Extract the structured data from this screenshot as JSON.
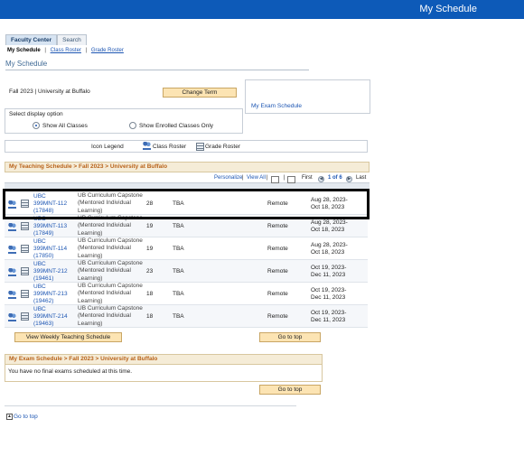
{
  "header": {
    "title": "My Schedule"
  },
  "tabs": [
    {
      "label": "Faculty Center",
      "active": true
    },
    {
      "label": "Search",
      "active": false
    }
  ],
  "subnav": {
    "current": "My Schedule",
    "links": [
      "Class Roster",
      "Grade Roster"
    ]
  },
  "page_title": "My Schedule",
  "term": {
    "label": "Fall 2023 | University at Buffalo",
    "change_button": "Change Term"
  },
  "exam_link": "My Exam Schedule",
  "display_option": {
    "label": "Select display option",
    "options": [
      {
        "label": "Show All Classes",
        "selected": true
      },
      {
        "label": "Show Enrolled Classes Only",
        "selected": false
      }
    ]
  },
  "legend": {
    "title": "Icon Legend",
    "class_roster": "Class Roster",
    "grade_roster": "Grade Roster"
  },
  "teaching": {
    "heading": "My Teaching Schedule > Fall 2023 > University at Buffalo",
    "nav": {
      "personalize": "Personalize",
      "view_all": "View All",
      "first": "First",
      "range": "1 of 6",
      "last": "Last"
    },
    "rows": [
      {
        "class_lines": [
          "UBC",
          "399MNT-112",
          "(17848)"
        ],
        "desc_lines": [
          "UB Curriculum Capstone",
          "(Mentored Individual",
          "Learning)"
        ],
        "enrolled": "28",
        "days_times": "TBA",
        "room": "Remote",
        "dates_lines": [
          "Aug 28, 2023-",
          "Oct 18, 2023"
        ]
      },
      {
        "class_lines": [
          "UBC",
          "399MNT-113",
          "(17849)"
        ],
        "desc_lines": [
          "UB Curriculum Capstone",
          "(Mentored Individual",
          "Learning)"
        ],
        "enrolled": "19",
        "days_times": "TBA",
        "room": "Remote",
        "dates_lines": [
          "Aug 28, 2023-",
          "Oct 18, 2023"
        ]
      },
      {
        "class_lines": [
          "UBC",
          "399MNT-114",
          "(17850)"
        ],
        "desc_lines": [
          "UB Curriculum Capstone",
          "(Mentored Individual",
          "Learning)"
        ],
        "enrolled": "19",
        "days_times": "TBA",
        "room": "Remote",
        "dates_lines": [
          "Aug 28, 2023-",
          "Oct 18, 2023"
        ]
      },
      {
        "class_lines": [
          "UBC",
          "399MNT-212",
          "(19461)"
        ],
        "desc_lines": [
          "UB Curriculum Capstone",
          "(Mentored Individual",
          "Learning)"
        ],
        "enrolled": "23",
        "days_times": "TBA",
        "room": "Remote",
        "dates_lines": [
          "Oct 19, 2023-",
          "Dec 11, 2023"
        ]
      },
      {
        "class_lines": [
          "UBC",
          "399MNT-213",
          "(19462)"
        ],
        "desc_lines": [
          "UB Curriculum Capstone",
          "(Mentored Individual",
          "Learning)"
        ],
        "enrolled": "18",
        "days_times": "TBA",
        "room": "Remote",
        "dates_lines": [
          "Oct 19, 2023-",
          "Dec 11, 2023"
        ]
      },
      {
        "class_lines": [
          "UBC",
          "399MNT-214",
          "(19463)"
        ],
        "desc_lines": [
          "UB Curriculum Capstone",
          "(Mentored Individual",
          "Learning)"
        ],
        "enrolled": "18",
        "days_times": "TBA",
        "room": "Remote",
        "dates_lines": [
          "Oct 19, 2023-",
          "Dec 11, 2023"
        ]
      }
    ],
    "weekly_button": "View Weekly Teaching Schedule",
    "go_to_top": "Go to top"
  },
  "exam": {
    "heading": "My Exam Schedule > Fall 2023 > University at Buffalo",
    "message": "You have no final exams scheduled at this time.",
    "go_to_top": "Go to top"
  },
  "bottom_go_to_top": "Go to top",
  "colors": {
    "topbar": "#0d5ab8",
    "link": "#1d56b3",
    "section_header_text": "#b8621a",
    "button_bg": "#fce4b3"
  }
}
